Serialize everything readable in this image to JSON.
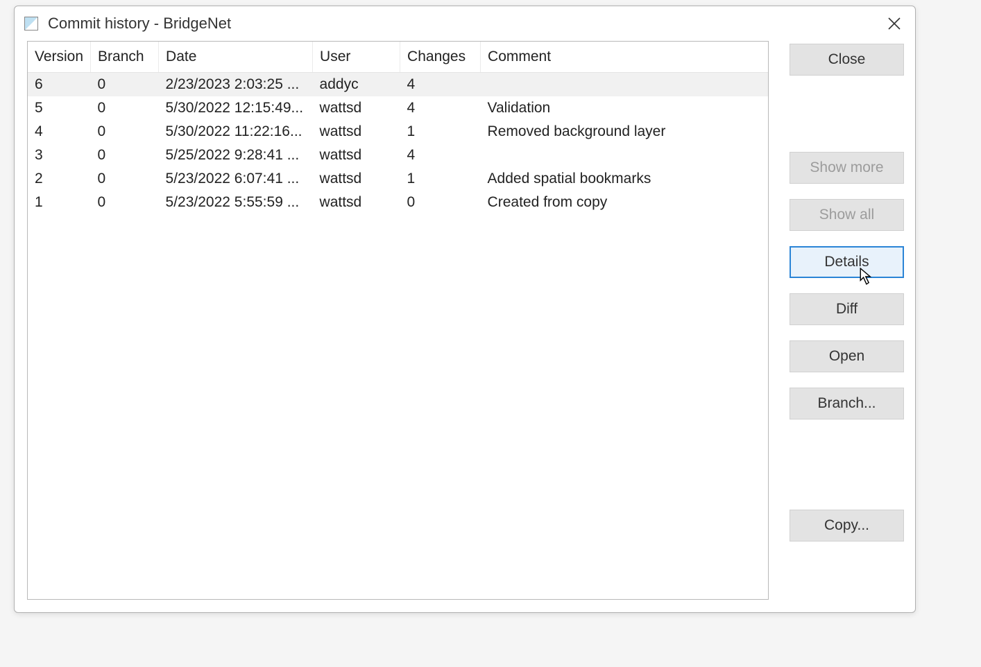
{
  "window": {
    "title": "Commit history - BridgeNet"
  },
  "table": {
    "headers": {
      "version": "Version",
      "branch": "Branch",
      "date": "Date",
      "user": "User",
      "changes": "Changes",
      "comment": "Comment"
    },
    "rows": [
      {
        "version": "6",
        "branch": "0",
        "date": "2/23/2023 2:03:25 ...",
        "user": "addyc",
        "changes": "4",
        "comment": "",
        "selected": true
      },
      {
        "version": "5",
        "branch": "0",
        "date": "5/30/2022 12:15:49...",
        "user": "wattsd",
        "changes": "4",
        "comment": "Validation"
      },
      {
        "version": "4",
        "branch": "0",
        "date": "5/30/2022 11:22:16...",
        "user": "wattsd",
        "changes": "1",
        "comment": "Removed background layer"
      },
      {
        "version": "3",
        "branch": "0",
        "date": "5/25/2022 9:28:41 ...",
        "user": "wattsd",
        "changes": "4",
        "comment": ""
      },
      {
        "version": "2",
        "branch": "0",
        "date": "5/23/2022 6:07:41 ...",
        "user": "wattsd",
        "changes": "1",
        "comment": "Added spatial bookmarks"
      },
      {
        "version": "1",
        "branch": "0",
        "date": "5/23/2022 5:55:59 ...",
        "user": "wattsd",
        "changes": "0",
        "comment": "Created from copy"
      }
    ]
  },
  "buttons": {
    "close": "Close",
    "show_more": "Show more",
    "show_all": "Show all",
    "details": "Details",
    "diff": "Diff",
    "open": "Open",
    "branch": "Branch...",
    "copy": "Copy..."
  }
}
